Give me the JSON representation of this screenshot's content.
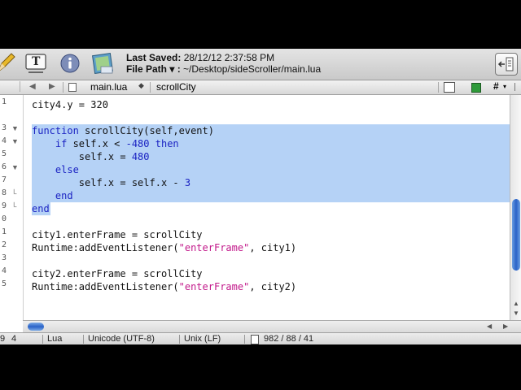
{
  "toolbar": {
    "last_saved_label": "Last Saved:",
    "last_saved_value": "28/12/12 2:37:58 PM",
    "file_path_label": "File Path ▾ :",
    "file_path_value": "~/Desktop/sideScroller/main.lua",
    "text_tool_glyph": "T"
  },
  "navbar": {
    "back_glyph": "◀",
    "forward_glyph": "▶",
    "file_menu": "main.lua",
    "function_menu": "scrollCity",
    "hash_glyph": "#"
  },
  "gutter": {
    "line_numbers": [
      "1",
      "",
      "3",
      "4",
      "5",
      "6",
      "7",
      "8",
      "9",
      "0",
      "1",
      "2",
      "3",
      "4",
      "5"
    ]
  },
  "code_lines": {
    "l1": "city4.y = 320",
    "l3a": "function",
    "l3b": " scrollCity(self,event)",
    "l4a": "    if",
    "l4b": " self.x < ",
    "l4c": "-480",
    "l4d": " then",
    "l5a": "        self.x = ",
    "l5b": "480",
    "l6": "    else",
    "l7a": "        self.x = self.x - ",
    "l7b": "3",
    "l8": "    end",
    "l9": "end",
    "l11": "city1.enterFrame = scrollCity",
    "l12a": "Runtime:addEventListener(",
    "l12b": "\"enterFrame\"",
    "l12c": ", city1)",
    "l14": "city2.enterFrame = scrollCity",
    "l15a": "Runtime:addEventListener(",
    "l15b": "\"enterFrame\"",
    "l15c": ", city2)"
  },
  "status": {
    "line_col_a": "9",
    "line_col_b": "4",
    "language": "Lua",
    "encoding": "Unicode (UTF-8)",
    "line_endings": "Unix (LF)",
    "counts": "982 / 88 / 41"
  },
  "colors": {
    "keyword": "#1a22c2",
    "string": "#c2188a",
    "selection": "#b5d2f6"
  }
}
